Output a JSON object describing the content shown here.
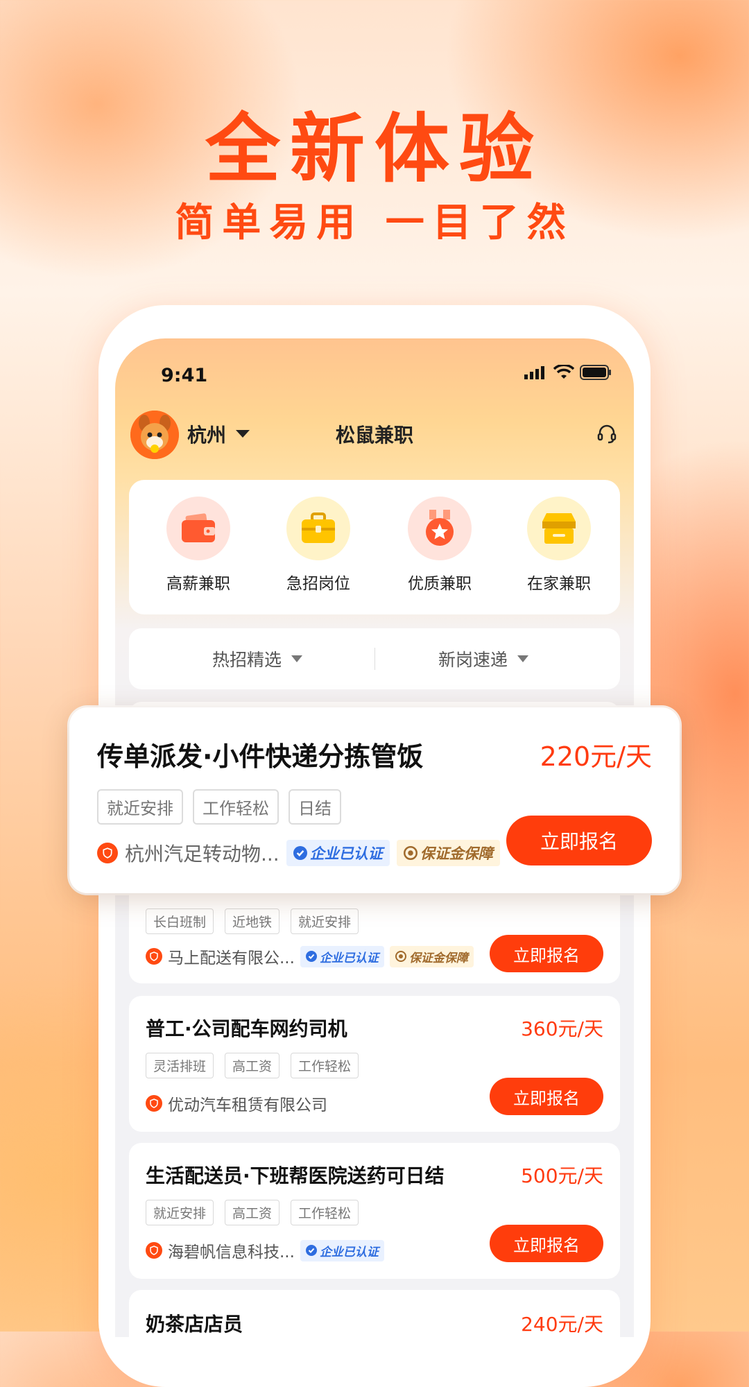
{
  "hero": {
    "title": "全新体验",
    "subtitle": "简单易用 一目了然"
  },
  "status_bar": {
    "time": "9:41"
  },
  "topbar": {
    "city": "杭州",
    "title": "松鼠兼职"
  },
  "categories": [
    {
      "label": "高薪兼职",
      "icon": "wallet-icon",
      "bg": "#ffe3dc",
      "color": "#ff5a30"
    },
    {
      "label": "急招岗位",
      "icon": "briefcase-icon",
      "bg": "#fff3c8",
      "color": "#ffc400"
    },
    {
      "label": "优质兼职",
      "icon": "medal-icon",
      "bg": "#ffe3dc",
      "color": "#ff5a30"
    },
    {
      "label": "在家兼职",
      "icon": "store-icon",
      "bg": "#fff3c8",
      "color": "#ffc400"
    }
  ],
  "filters": [
    {
      "label": "热招精选"
    },
    {
      "label": "新岗速递"
    }
  ],
  "featured_job": {
    "title": "传单派发·小件快递分拣管饭",
    "price": "220元/天",
    "tags": [
      "就近安排",
      "工作轻松",
      "日结"
    ],
    "company": "杭州汽足转动物...",
    "verified": "企业已认证",
    "deposit": "保证金保障",
    "apply": "立即报名"
  },
  "jobs": [
    {
      "title": "",
      "price": "",
      "tags": [
        "长白班制",
        "近地铁",
        "就近安排"
      ],
      "company": "马上配送有限公...",
      "verified": "企业已认证",
      "deposit": "保证金保障",
      "apply": "立即报名"
    },
    {
      "title": "普工·公司配车网约司机",
      "price": "360元/天",
      "tags": [
        "灵活排班",
        "高工资",
        "工作轻松"
      ],
      "company": "优动汽车租赁有限公司",
      "apply": "立即报名"
    },
    {
      "title": "生活配送员·下班帮医院送药可日结",
      "price": "500元/天",
      "tags": [
        "就近安排",
        "高工资",
        "工作轻松"
      ],
      "company": "海碧帆信息科技...",
      "verified": "企业已认证",
      "apply": "立即报名"
    },
    {
      "title": "奶茶店店员",
      "price": "240元/天"
    }
  ],
  "colors": {
    "accent": "#ff3d0c",
    "hero": "#ff4a12",
    "verified": "#2e6de0",
    "deposit": "#a06a2c"
  }
}
